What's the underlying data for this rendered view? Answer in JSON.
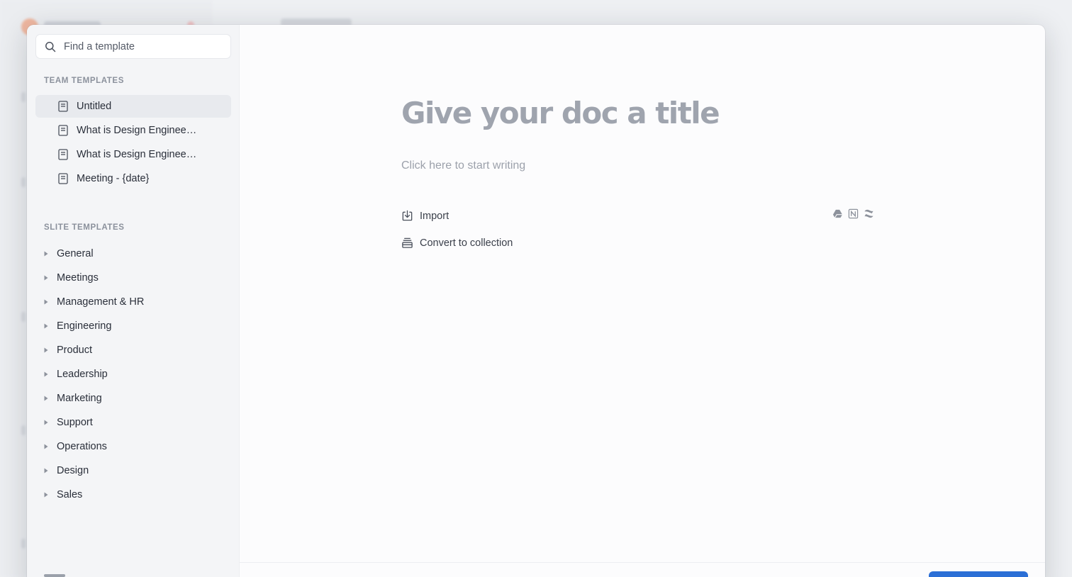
{
  "search": {
    "placeholder": "Find a template"
  },
  "team_templates": {
    "title": "TEAM TEMPLATES",
    "items": [
      {
        "label": "Untitled",
        "active": true
      },
      {
        "label": "What is Design Engineer…",
        "active": false
      },
      {
        "label": "What is Design Engineer…",
        "active": false
      },
      {
        "label": "Meeting - {date}",
        "active": false
      }
    ]
  },
  "slite_templates": {
    "title": "SLITE TEMPLATES",
    "items": [
      {
        "label": "General"
      },
      {
        "label": "Meetings"
      },
      {
        "label": "Management & HR"
      },
      {
        "label": "Engineering"
      },
      {
        "label": "Product"
      },
      {
        "label": "Leadership"
      },
      {
        "label": "Marketing"
      },
      {
        "label": "Support"
      },
      {
        "label": "Operations"
      },
      {
        "label": "Design"
      },
      {
        "label": "Sales"
      }
    ]
  },
  "editor": {
    "title_placeholder": "Give your doc a title",
    "body_placeholder": "Click here to start writing",
    "actions": {
      "import": "Import",
      "convert": "Convert to collection"
    },
    "import_sources": [
      "google-drive-icon",
      "notion-icon",
      "confluence-icon"
    ]
  },
  "colors": {
    "accent": "#2b6fd6",
    "sidebar_bg": "#f4f5f7",
    "active_item_bg": "#e8eaee"
  }
}
